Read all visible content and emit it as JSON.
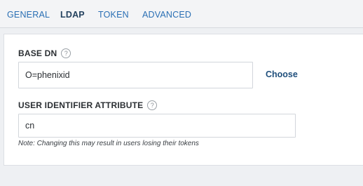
{
  "tabs": [
    {
      "label": "GENERAL",
      "active": false
    },
    {
      "label": "LDAP",
      "active": true
    },
    {
      "label": "TOKEN",
      "active": false
    },
    {
      "label": "ADVANCED",
      "active": false
    }
  ],
  "base_dn": {
    "label": "BASE DN",
    "help_icon": "question-circle",
    "value": "O=phenixid",
    "choose_label": "Choose"
  },
  "user_identifier": {
    "label": "USER IDENTIFIER ATTRIBUTE",
    "help_icon": "question-circle",
    "value": "cn",
    "note": "Note: Changing this may result in users losing their tokens"
  },
  "help_glyph": "?",
  "colors": {
    "tab_link": "#2a6fb4",
    "tab_active": "#24425f",
    "choose_link": "#1f4f7c",
    "background": "#eef0f3",
    "panel": "#ffffff"
  }
}
